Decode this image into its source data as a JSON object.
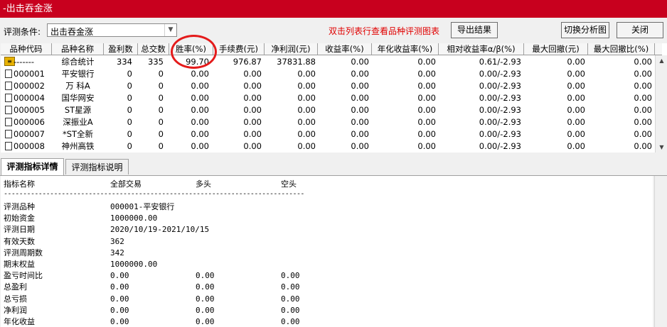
{
  "window": {
    "title": "-出击吞金涨"
  },
  "toolbar": {
    "condition_label": "评测条件:",
    "condition_value": "出击吞金涨",
    "hint": "双击列表行查看品种评测图表",
    "export_label": "导出结果",
    "switch_label": "切换分析图",
    "close_label": "关闭"
  },
  "grid": {
    "headers": [
      "品种代码",
      "品种名称",
      "盈利数",
      "总交数",
      "胜率(%)",
      "手续费(元)",
      "净利润(元)",
      "收益率(%)",
      "年化收益率(%)",
      "相对收益率α/β(%)",
      "最大回撤(元)",
      "最大回撤比(%)"
    ],
    "rows": [
      {
        "code": "-------",
        "name": "综合统计",
        "win": "334",
        "total": "335",
        "rate": "99.70",
        "fee": "976.87",
        "profit": "37831.88",
        "ret": "0.00",
        "annual": "0.00",
        "rel": "0.61/-2.93",
        "dd": "0.00",
        "ddr": "0.00",
        "icon": "sum"
      },
      {
        "code": "000001",
        "name": "平安银行",
        "win": "0",
        "total": "0",
        "rate": "0.00",
        "fee": "0.00",
        "profit": "0.00",
        "ret": "0.00",
        "annual": "0.00",
        "rel": "0.00/-2.93",
        "dd": "0.00",
        "ddr": "0.00",
        "icon": "doc"
      },
      {
        "code": "000002",
        "name": "万 科A",
        "win": "0",
        "total": "0",
        "rate": "0.00",
        "fee": "0.00",
        "profit": "0.00",
        "ret": "0.00",
        "annual": "0.00",
        "rel": "0.00/-2.93",
        "dd": "0.00",
        "ddr": "0.00",
        "icon": "doc"
      },
      {
        "code": "000004",
        "name": "国华网安",
        "win": "0",
        "total": "0",
        "rate": "0.00",
        "fee": "0.00",
        "profit": "0.00",
        "ret": "0.00",
        "annual": "0.00",
        "rel": "0.00/-2.93",
        "dd": "0.00",
        "ddr": "0.00",
        "icon": "doc"
      },
      {
        "code": "000005",
        "name": "ST星源",
        "win": "0",
        "total": "0",
        "rate": "0.00",
        "fee": "0.00",
        "profit": "0.00",
        "ret": "0.00",
        "annual": "0.00",
        "rel": "0.00/-2.93",
        "dd": "0.00",
        "ddr": "0.00",
        "icon": "doc"
      },
      {
        "code": "000006",
        "name": "深振业A",
        "win": "0",
        "total": "0",
        "rate": "0.00",
        "fee": "0.00",
        "profit": "0.00",
        "ret": "0.00",
        "annual": "0.00",
        "rel": "0.00/-2.93",
        "dd": "0.00",
        "ddr": "0.00",
        "icon": "doc"
      },
      {
        "code": "000007",
        "name": "*ST全新",
        "win": "0",
        "total": "0",
        "rate": "0.00",
        "fee": "0.00",
        "profit": "0.00",
        "ret": "0.00",
        "annual": "0.00",
        "rel": "0.00/-2.93",
        "dd": "0.00",
        "ddr": "0.00",
        "icon": "doc"
      },
      {
        "code": "000008",
        "name": "神州高铁",
        "win": "0",
        "total": "0",
        "rate": "0.00",
        "fee": "0.00",
        "profit": "0.00",
        "ret": "0.00",
        "annual": "0.00",
        "rel": "0.00/-2.93",
        "dd": "0.00",
        "ddr": "0.00",
        "icon": "doc"
      }
    ]
  },
  "tabs": [
    {
      "label": "评测指标详情"
    },
    {
      "label": "评测指标说明"
    }
  ],
  "detail": {
    "header": [
      "指标名称",
      "全部交易",
      "多头",
      "空头"
    ],
    "separator": "------------------------------------------------------------------------------",
    "lines": [
      {
        "label": "评测品种",
        "v1": "000001-平安银行",
        "v2": "",
        "v3": ""
      },
      {
        "label": "初始资金",
        "v1": "1000000.00",
        "v2": "",
        "v3": ""
      },
      {
        "label": "评测日期",
        "v1": "2020/10/19-2021/10/15",
        "v2": "",
        "v3": ""
      },
      {
        "label": "有效天数",
        "v1": "362",
        "v2": "",
        "v3": ""
      },
      {
        "label": "评测周期数",
        "v1": "342",
        "v2": "",
        "v3": ""
      },
      {
        "label": "期末权益",
        "v1": "1000000.00",
        "v2": "",
        "v3": ""
      },
      {
        "label": "盈亏时间比",
        "v1": "0.00",
        "v2": "0.00",
        "v3": "0.00"
      },
      {
        "label": "总盈利",
        "v1": "0.00",
        "v2": "0.00",
        "v3": "0.00"
      },
      {
        "label": "总亏损",
        "v1": "0.00",
        "v2": "0.00",
        "v3": "0.00"
      },
      {
        "label": "净利润",
        "v1": "0.00",
        "v2": "0.00",
        "v3": "0.00"
      },
      {
        "label": "年化收益",
        "v1": "0.00",
        "v2": "0.00",
        "v3": "0.00"
      }
    ]
  }
}
